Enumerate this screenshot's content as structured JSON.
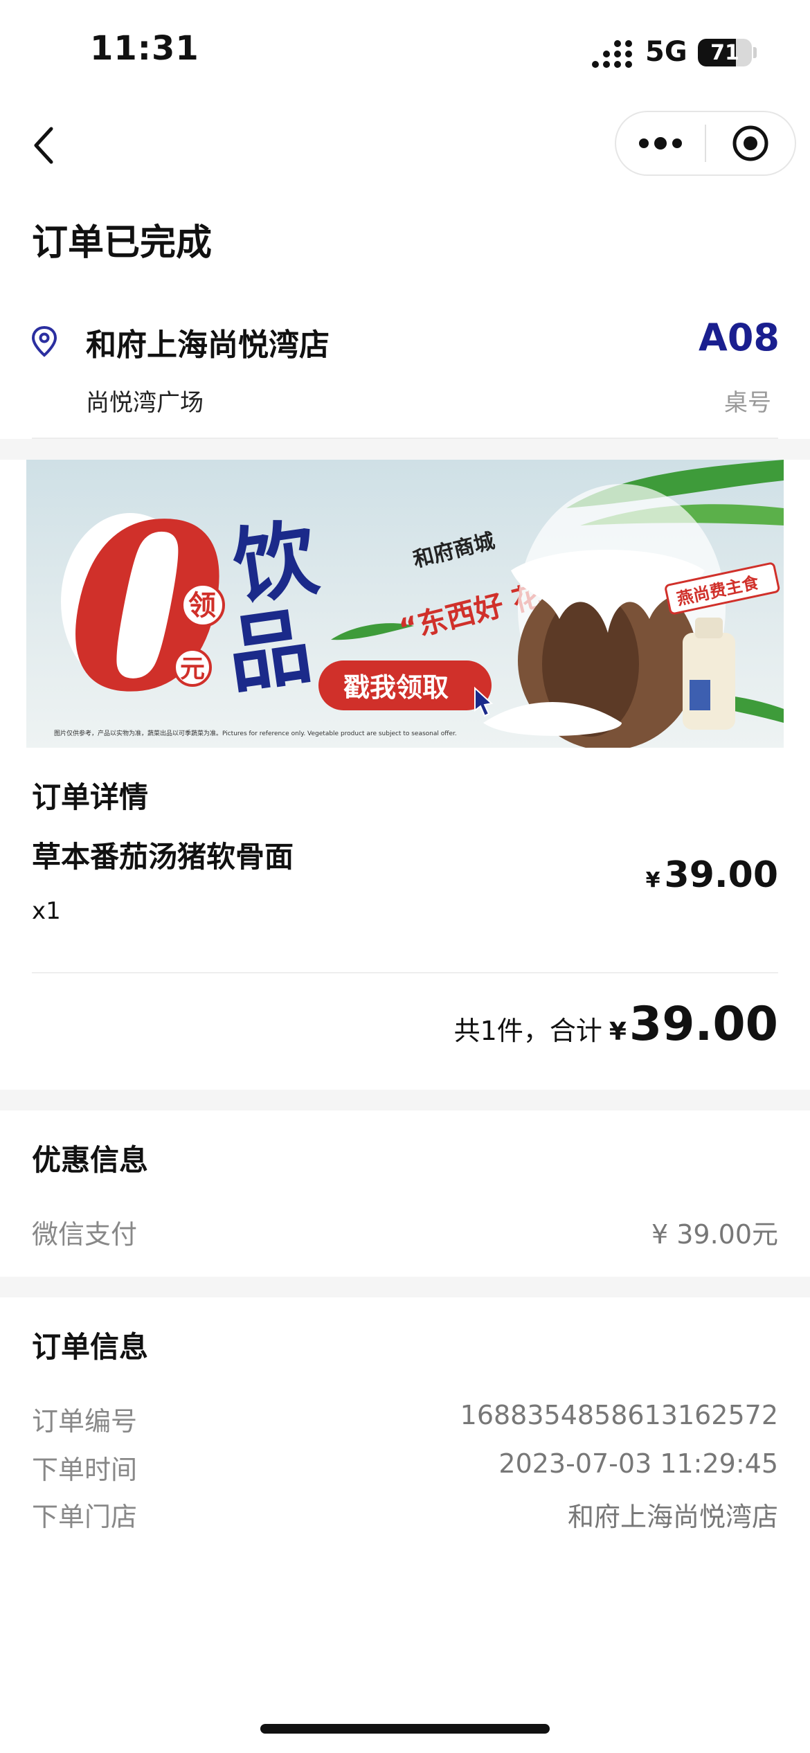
{
  "status_bar": {
    "time": "11:31",
    "network": "5G",
    "battery": "71",
    "battery_level": 0.71
  },
  "page": {
    "title": "订单已完成"
  },
  "store": {
    "name": "和府上海尚悦湾店",
    "subtitle": "尚悦湾广场",
    "table_number": "A08",
    "table_label": "桌号"
  },
  "banner": {
    "big_zero": "0",
    "ling": "领",
    "yuan": "元",
    "yin": "饮",
    "pin": "品",
    "mall": "和府商城",
    "slogan": "“东西好 花钱少”",
    "cta": "戳我领取",
    "badge": "燕尚费主食",
    "disclaimer": "图片仅供参考，产品以实物为准，蔬菜出品以可季蔬菜为准。Pictures for reference only. Vegetable product are subject to seasonal offer."
  },
  "order_details": {
    "title": "订单详情",
    "items": [
      {
        "name": "草本番茄汤猪软骨面",
        "qty": "x1",
        "currency": "¥",
        "price": "39.00"
      }
    ],
    "total_label": "共1件，合计",
    "total_currency": "¥",
    "total_amount": "39.00"
  },
  "discount": {
    "title": "优惠信息",
    "method": "微信支付",
    "amount": "¥ 39.00元"
  },
  "order_info": {
    "title": "订单信息",
    "rows": [
      {
        "label": "订单编号",
        "value": "1688354858613162572"
      },
      {
        "label": "下单时间",
        "value": "2023-07-03 11:29:45"
      },
      {
        "label": "下单门店",
        "value": "和府上海尚悦湾店"
      }
    ]
  },
  "colors": {
    "accent_blue": "#1a1f8f",
    "banner_red": "#d0302a",
    "banner_navy": "#1b2a8a"
  }
}
